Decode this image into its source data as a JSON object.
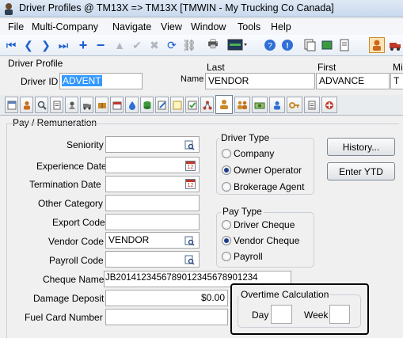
{
  "window": {
    "title": "Driver Profiles @ TM13X => TM13X [TMWIN - My Trucking Co Canada]"
  },
  "menu": [
    "File",
    "Multi-Company",
    "Navigate",
    "View",
    "Window",
    "Tools",
    "Help"
  ],
  "header": {
    "section_label": "Driver Profile",
    "driver_id_label": "Driver ID",
    "driver_id_value": "ADVENT",
    "name_label": "Name",
    "last_label": "Last",
    "last_value": "VENDOR",
    "first_label": "First",
    "first_value": "ADVANCE",
    "mi_label": "Mi",
    "mi_value": "T"
  },
  "section": {
    "title": "Pay / Remuneration"
  },
  "fields": {
    "seniority": {
      "label": "Seniority",
      "value": ""
    },
    "experience_date": {
      "label": "Experience Date",
      "value": ""
    },
    "termination_date": {
      "label": "Termination Date",
      "value": ""
    },
    "other_category": {
      "label": "Other Category",
      "value": ""
    },
    "export_code": {
      "label": "Export Code",
      "value": ""
    },
    "vendor_code": {
      "label": "Vendor Code",
      "value": "VENDOR"
    },
    "payroll_code": {
      "label": "Payroll Code",
      "value": ""
    },
    "cheque_name": {
      "label": "Cheque Name",
      "value": "JB20141234567890123456789​01234"
    },
    "damage_deposit": {
      "label": "Damage Deposit",
      "value": "$0.00"
    },
    "fuel_card_number": {
      "label": "Fuel Card Number",
      "value": ""
    }
  },
  "driver_type": {
    "label": "Driver Type",
    "options": [
      "Company",
      "Owner Operator",
      "Brokerage Agent"
    ],
    "selected": "Owner Operator"
  },
  "pay_type": {
    "label": "Pay Type",
    "options": [
      "Driver Cheque",
      "Vendor Cheque",
      "Payroll"
    ],
    "selected": "Vendor Cheque"
  },
  "buttons": {
    "history": "History...",
    "enter_ytd": "Enter YTD"
  },
  "overtime": {
    "label": "Overtime Calculation",
    "day_label": "Day",
    "day_value": "",
    "week_label": "Week",
    "week_value": ""
  },
  "colors": {
    "accent": "#1e5fd0",
    "highlight": "#3399ff",
    "callout_border": "#000000"
  }
}
